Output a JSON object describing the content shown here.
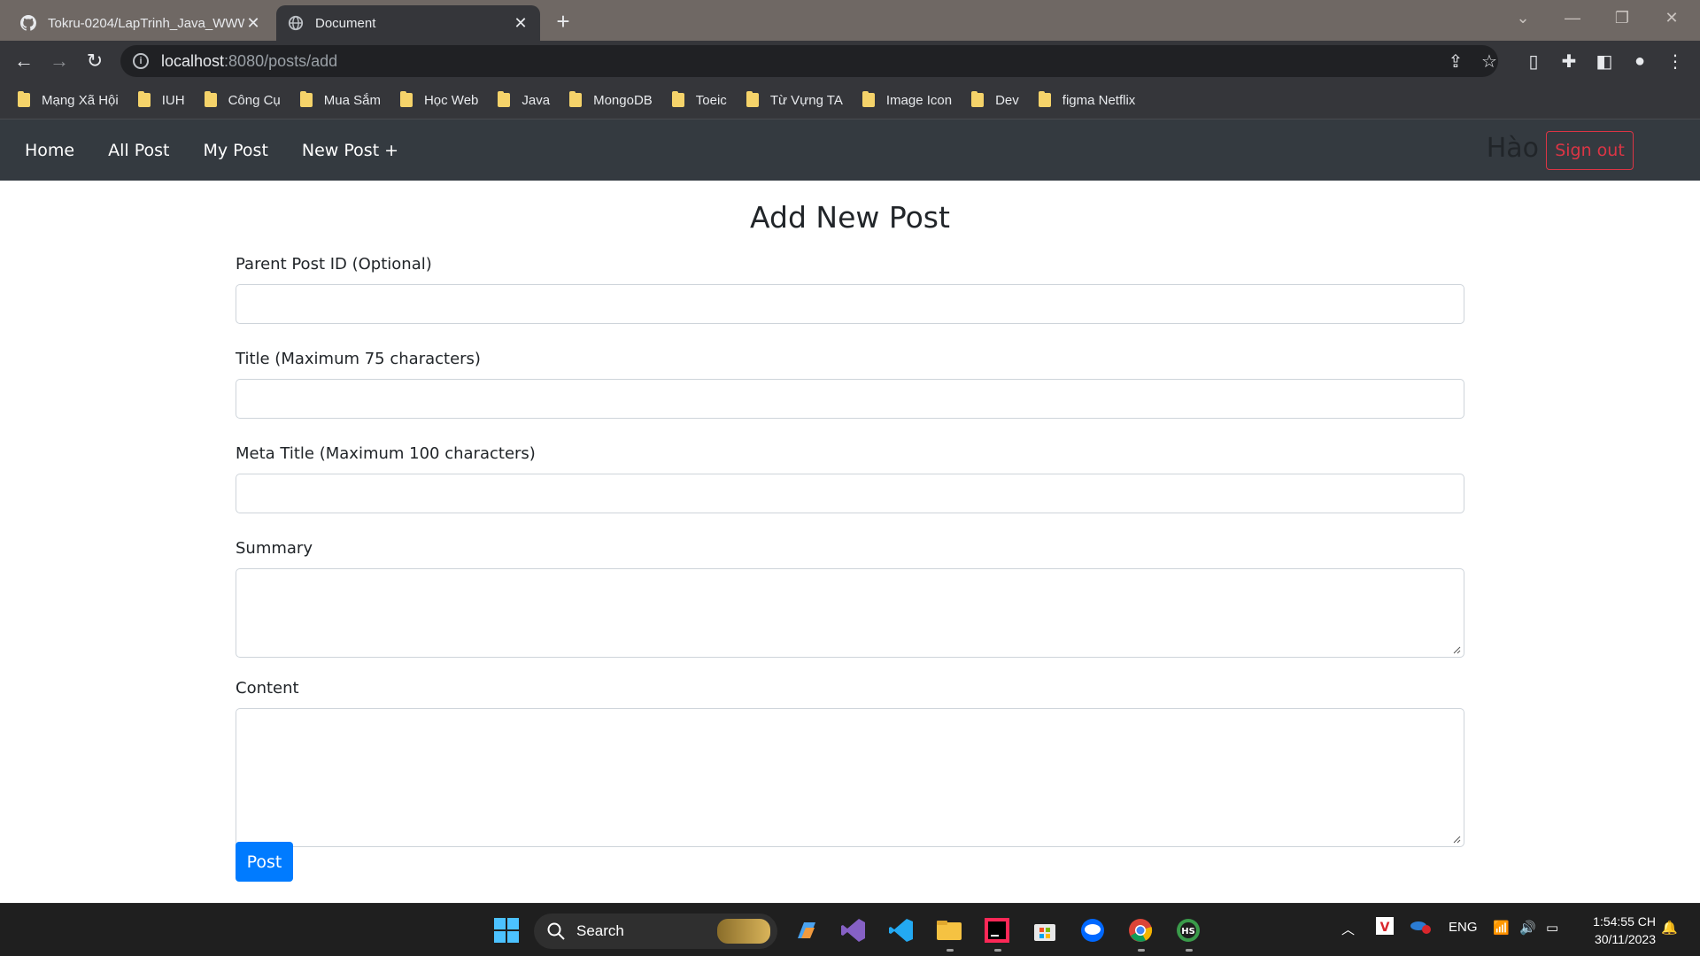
{
  "browser": {
    "tabs": [
      {
        "title": "Tokru-0204/LapTrinh_Java_WWW",
        "icon": "github-icon",
        "active": false
      },
      {
        "title": "Document",
        "icon": "globe-icon",
        "active": true
      }
    ],
    "url_host": "localhost",
    "url_path": ":8080/posts/add",
    "bookmarks": [
      "Mạng Xã Hội",
      "IUH",
      "Công Cụ",
      "Mua Sắm",
      "Học Web",
      "Java",
      "MongoDB",
      "Toeic",
      "Từ Vựng TA",
      "Image Icon",
      "Dev",
      "figma Netflix"
    ]
  },
  "nav": {
    "home": "Home",
    "all_post": "All Post",
    "my_post": "My Post",
    "new_post": "New Post +",
    "user_name": "Hào",
    "sign_out": "Sign out"
  },
  "form": {
    "title": "Add New Post",
    "parent_label": "Parent Post ID (Optional)",
    "parent_value": "",
    "title_label": "Title (Maximum 75 characters)",
    "title_value": "",
    "meta_label": "Meta Title (Maximum 100 characters)",
    "meta_value": "",
    "summary_label": "Summary",
    "content_label": "Content",
    "submit": "Post"
  },
  "taskbar": {
    "search_label": "Search",
    "lang": "ENG",
    "time": "1:54:55 CH",
    "date": "30/11/2023"
  },
  "colors": {
    "nav_bg": "#343a40",
    "primary": "#007bff",
    "danger": "#dc3545"
  }
}
